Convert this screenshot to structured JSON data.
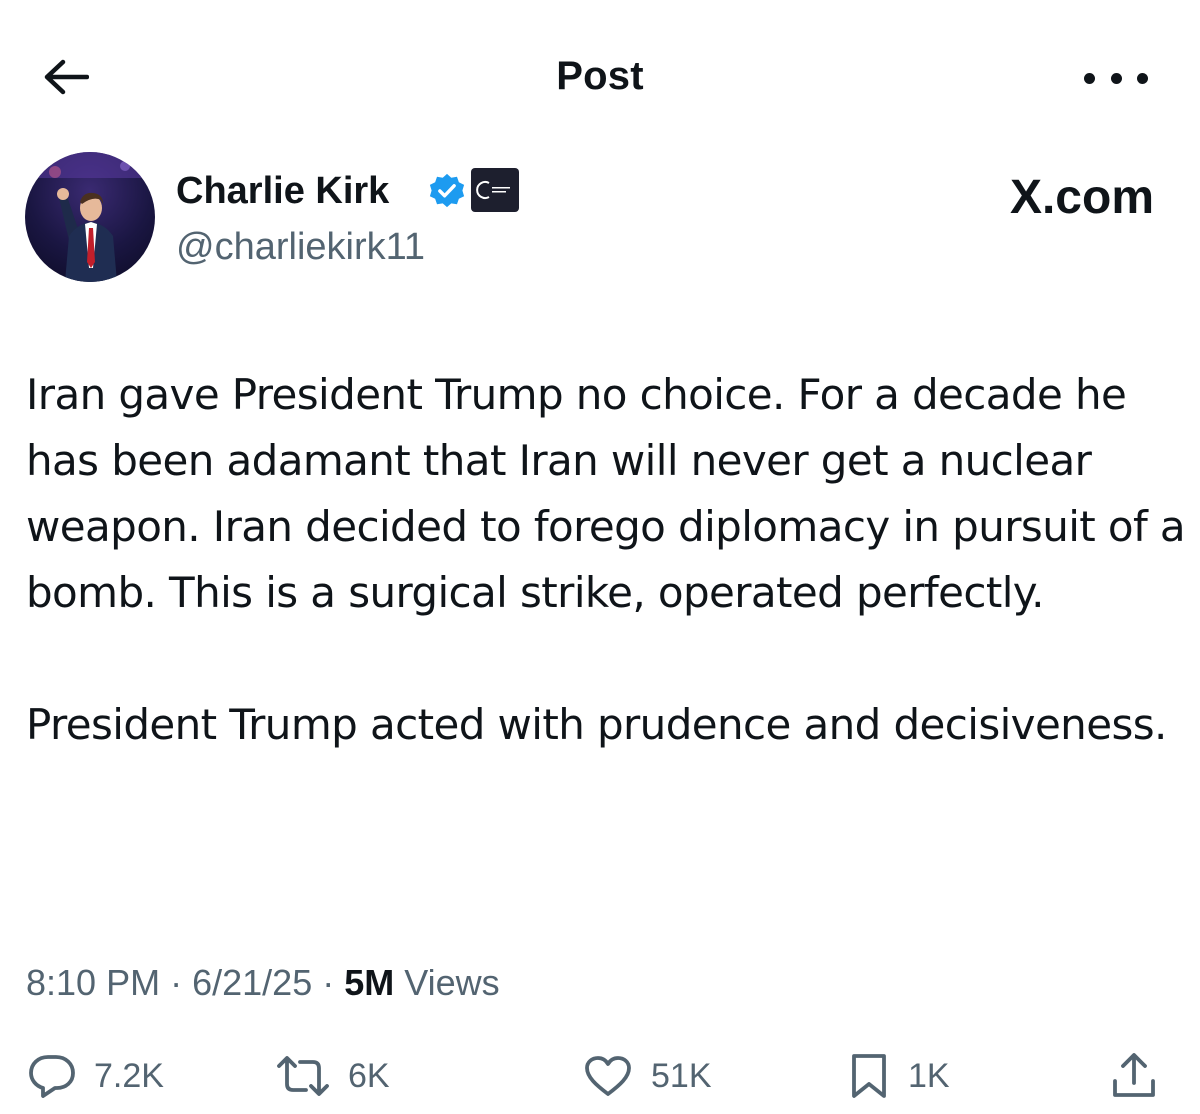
{
  "header": {
    "title": "Post",
    "back_icon": "arrow-left-icon",
    "more_icon": "more-horizontal-icon"
  },
  "author": {
    "name": "Charlie Kirk",
    "handle": "@charliekirk11",
    "verified": true,
    "verified_color": "#1d9bf0",
    "org_badge_icon": "turning-point-usa-badge"
  },
  "watermark": "X.com",
  "post": {
    "paragraphs": [
      "Iran gave President Trump no choice. For a decade he has been adamant that Iran will never get a nuclear weapon. Iran decided to forego diplomacy in pursuit of a bomb. This is a surgical strike, operated perfectly.",
      "President Trump acted with prudence and decisiveness."
    ]
  },
  "meta": {
    "time": "8:10 PM",
    "separator": "·",
    "date": "6/21/25",
    "views_count": "5M",
    "views_label": "Views"
  },
  "actions": {
    "reply": {
      "icon": "reply-icon",
      "count": "7.2K"
    },
    "repost": {
      "icon": "repost-icon",
      "count": "6K"
    },
    "like": {
      "icon": "heart-icon",
      "count": "51K"
    },
    "bookmark": {
      "icon": "bookmark-icon",
      "count": "1K"
    },
    "share": {
      "icon": "share-icon"
    }
  },
  "colors": {
    "text": "#0f1419",
    "secondary": "#536471",
    "accent": "#1d9bf0",
    "background": "#ffffff"
  }
}
